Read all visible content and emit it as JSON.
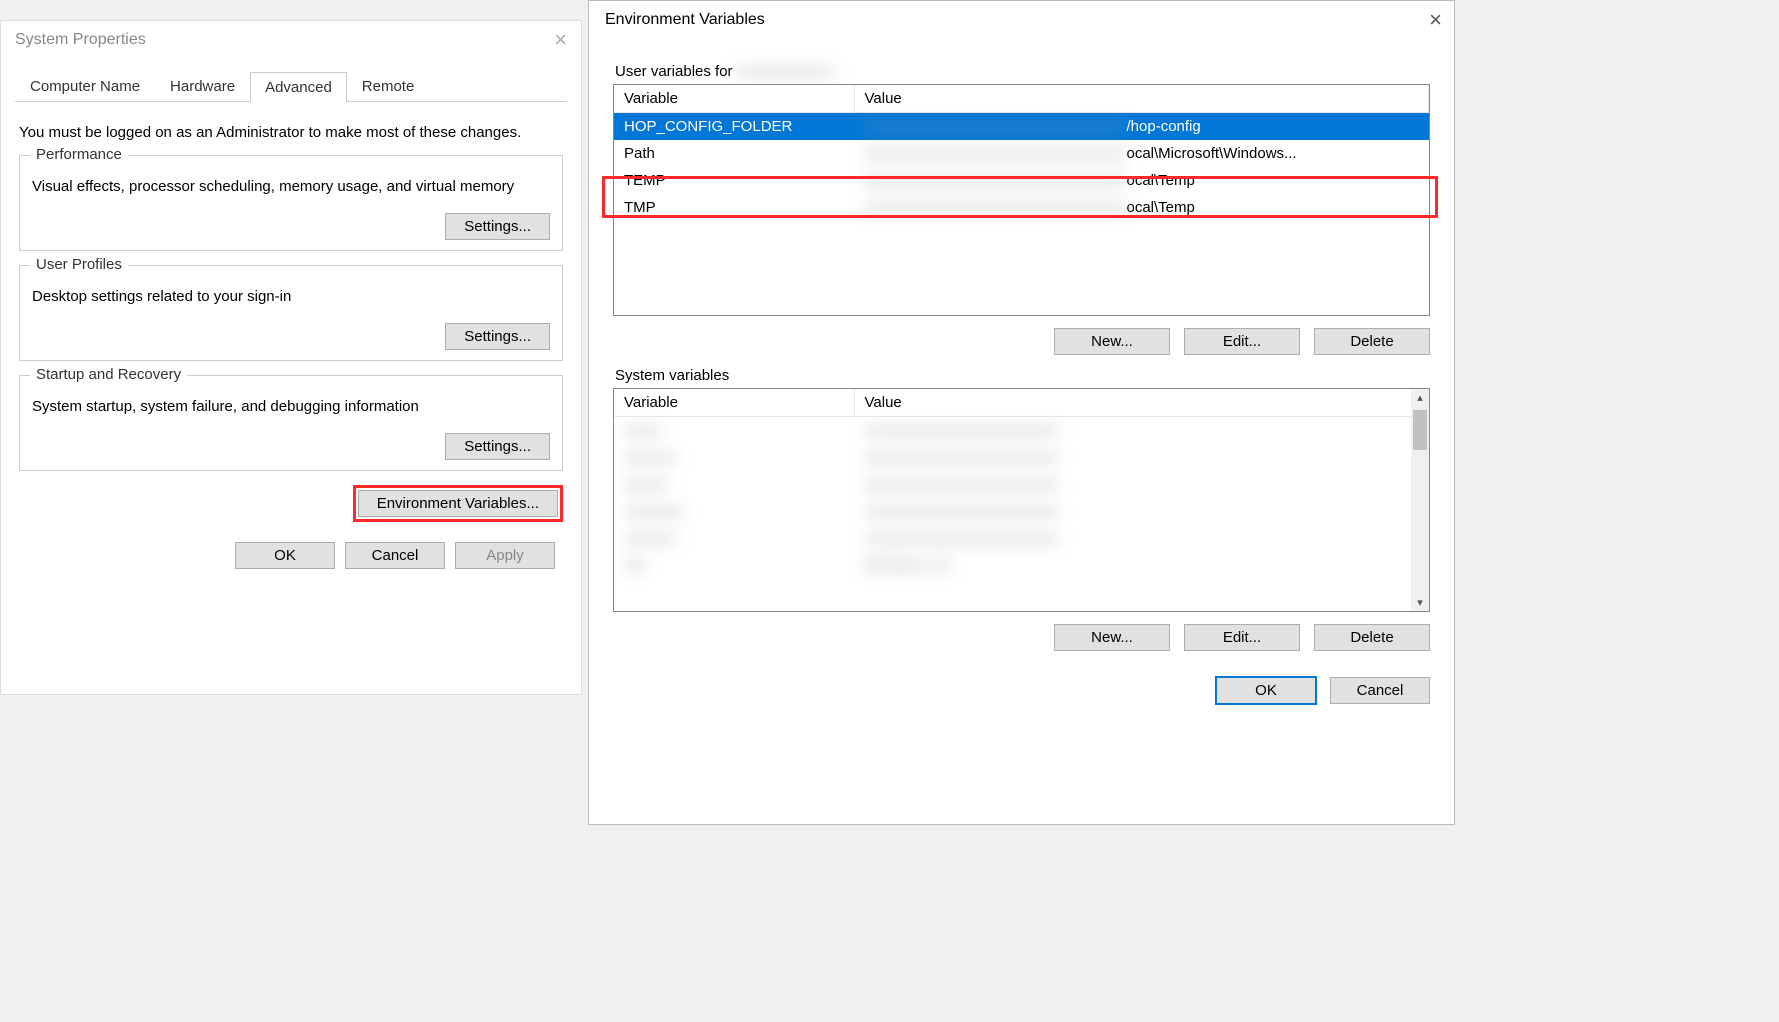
{
  "sysprops": {
    "title": "System Properties",
    "tabs": [
      "Computer Name",
      "Hardware",
      "Advanced",
      "Remote"
    ],
    "active_tab_index": 2,
    "intro": "You must be logged on as an Administrator to make most of these changes.",
    "groups": {
      "performance": {
        "legend": "Performance",
        "desc": "Visual effects, processor scheduling, memory usage, and virtual memory",
        "button": "Settings..."
      },
      "user_profiles": {
        "legend": "User Profiles",
        "desc": "Desktop settings related to your sign-in",
        "button": "Settings..."
      },
      "startup": {
        "legend": "Startup and Recovery",
        "desc": "System startup, system failure, and debugging information",
        "button": "Settings..."
      }
    },
    "env_button": "Environment Variables...",
    "ok": "OK",
    "cancel": "Cancel",
    "apply": "Apply"
  },
  "envdlg": {
    "title": "Environment Variables",
    "user_section_label": "User variables for",
    "cols": {
      "variable": "Variable",
      "value": "Value"
    },
    "user_vars": [
      {
        "name": "HOP_CONFIG_FOLDER",
        "value": "/hop-config",
        "selected": true
      },
      {
        "name": "Path",
        "value": "ocal\\Microsoft\\Windows..."
      },
      {
        "name": "TEMP",
        "value": "ocal\\Temp"
      },
      {
        "name": "TMP",
        "value": "ocal\\Temp"
      }
    ],
    "sys_section_label": "System variables",
    "sys_vars_placeholder": [
      {
        "name": " ",
        "value": " "
      },
      {
        "name": " ",
        "value": " "
      },
      {
        "name": " ",
        "value": " "
      },
      {
        "name": " ",
        "value": " "
      },
      {
        "name": "OS",
        "value": "Windows_NT"
      }
    ],
    "buttons": {
      "new": "New...",
      "edit": "Edit...",
      "delete": "Delete",
      "ok": "OK",
      "cancel": "Cancel"
    }
  }
}
